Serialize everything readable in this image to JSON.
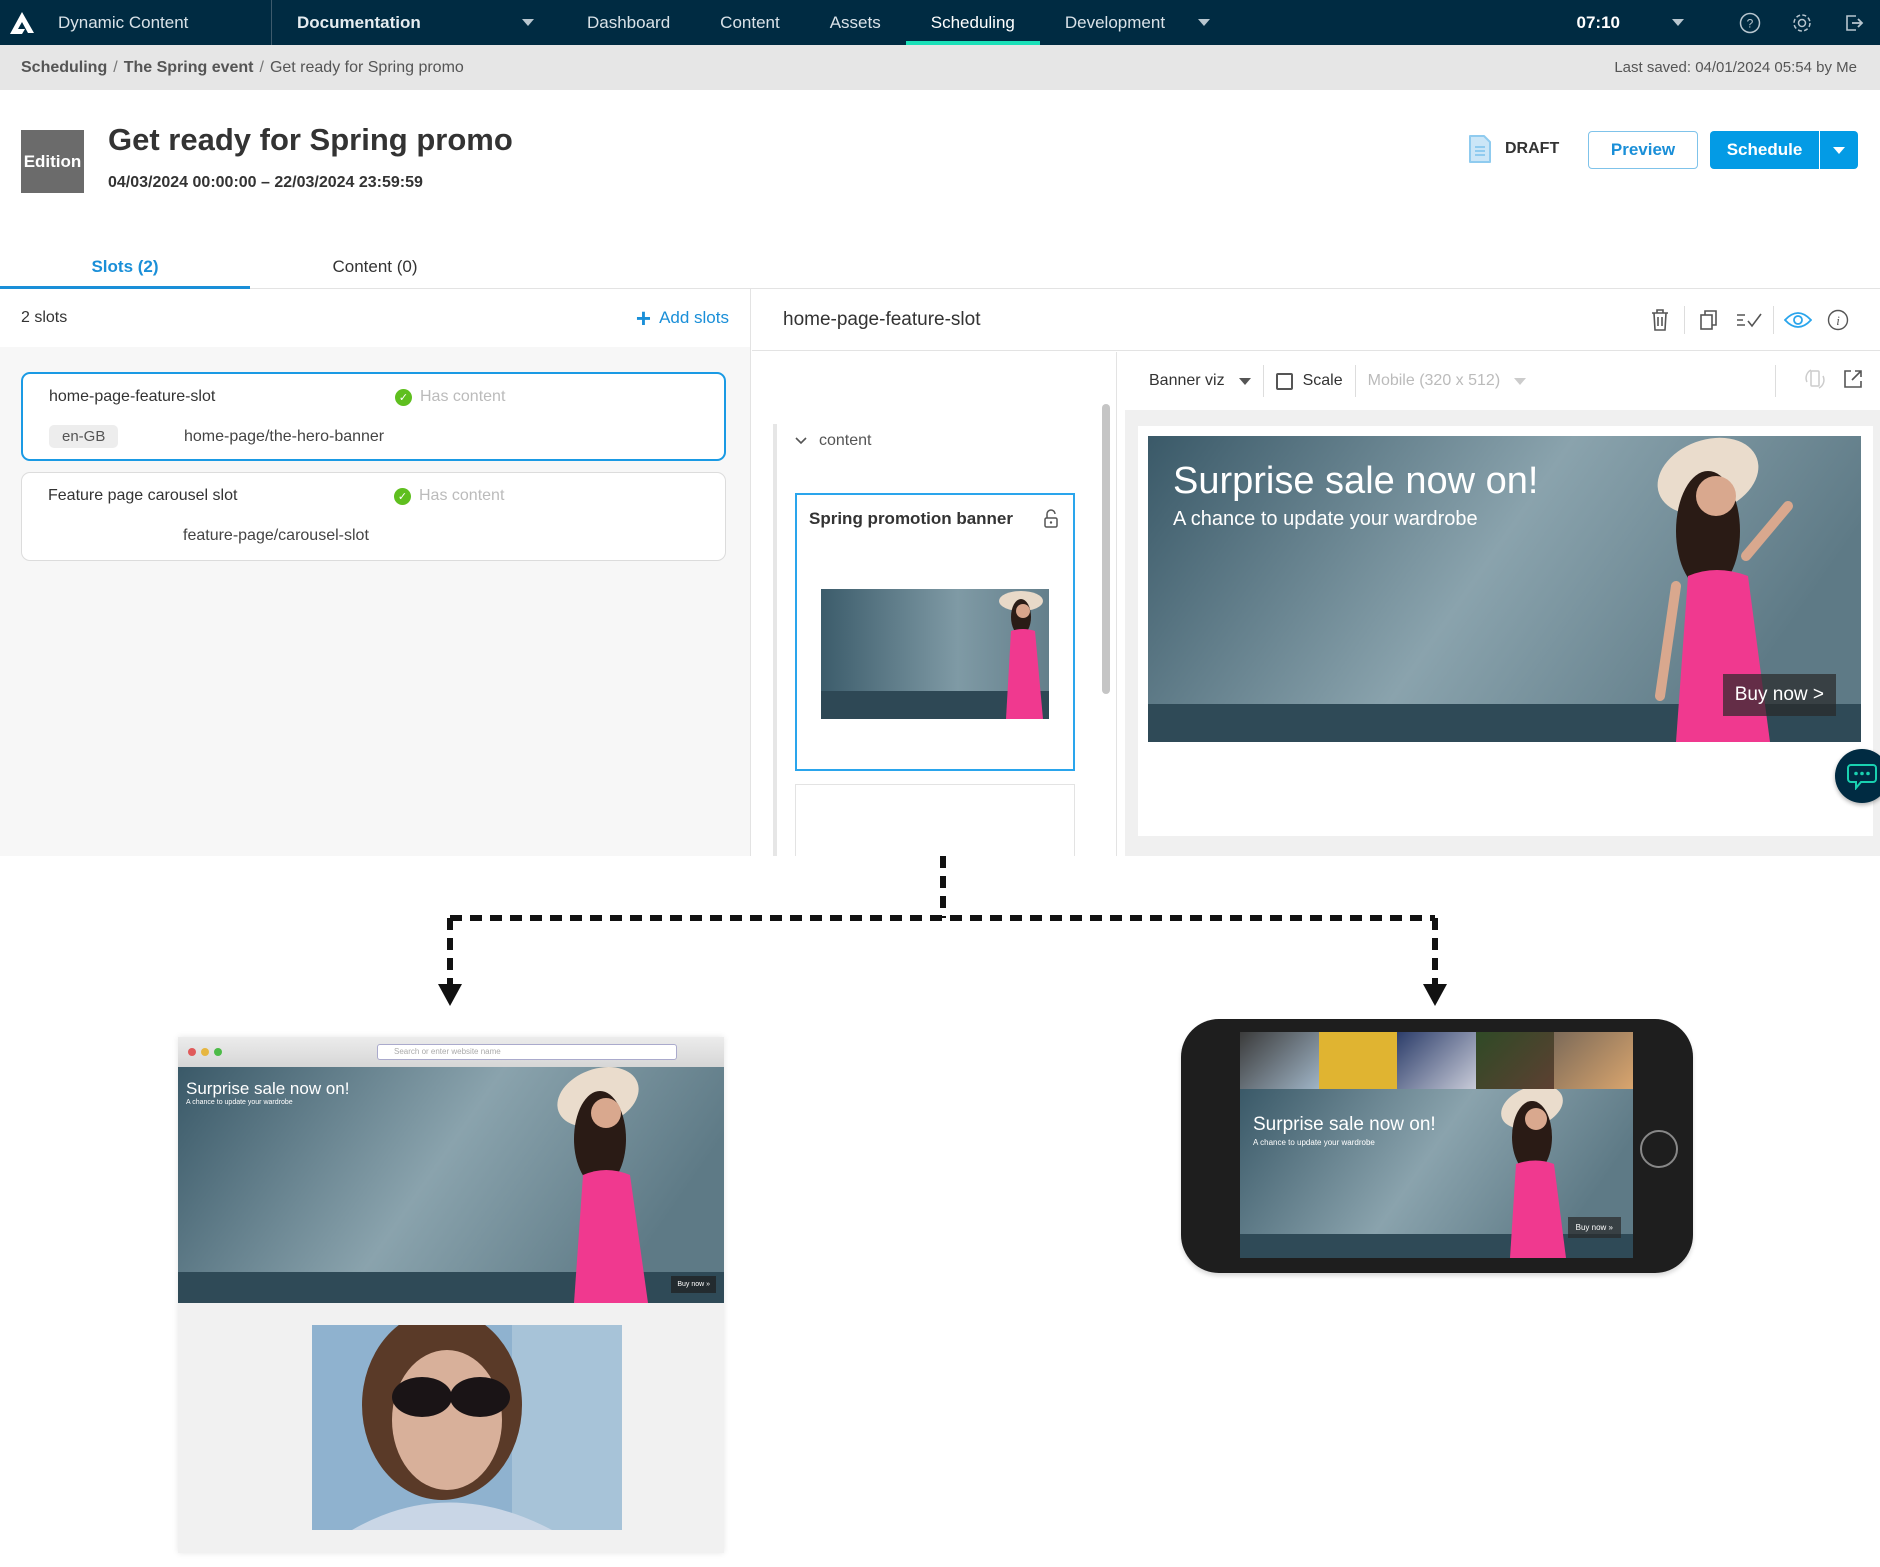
{
  "topnav": {
    "app_title": "Dynamic Content",
    "hub": "Documentation",
    "items": [
      {
        "label": "Dashboard",
        "active": false
      },
      {
        "label": "Content",
        "active": false
      },
      {
        "label": "Assets",
        "active": false
      },
      {
        "label": "Scheduling",
        "active": true
      },
      {
        "label": "Development",
        "active": false
      }
    ],
    "clock": "07:10",
    "icons": [
      "help-icon",
      "settings-icon",
      "logout-icon"
    ]
  },
  "breadcrumb": {
    "items": [
      "Scheduling",
      "The Spring event",
      "Get ready for Spring promo"
    ],
    "last_saved": "Last saved: 04/01/2024 05:54 by Me"
  },
  "header": {
    "badge": "Edition",
    "title": "Get ready for Spring promo",
    "dates": "04/03/2024 00:00:00  –  22/03/2024 23:59:59",
    "status": "DRAFT",
    "preview_label": "Preview",
    "schedule_label": "Schedule"
  },
  "tabs": [
    {
      "label": "Slots (2)",
      "active": true
    },
    {
      "label": "Content (0)",
      "active": false
    }
  ],
  "slots_panel": {
    "count_label": "2 slots",
    "add_label": "Add slots",
    "slots": [
      {
        "name": "home-page-feature-slot",
        "status": "Has content",
        "locale": "en-GB",
        "path": "home-page/the-hero-banner",
        "selected": true
      },
      {
        "name": "Feature page carousel slot",
        "status": "Has content",
        "locale": "",
        "path": "feature-page/carousel-slot",
        "selected": false
      }
    ]
  },
  "slot_detail": {
    "title": "home-page-feature-slot",
    "tree_label": "content",
    "content_item_title": "Spring promotion banner",
    "viz_select": "Banner viz",
    "scale_label": "Scale",
    "device_select": "Mobile (320 x 512)"
  },
  "banner": {
    "headline": "Surprise sale now on!",
    "subhead": "A chance to update your wardrobe",
    "cta": "Buy now >",
    "cta_small": "Buy now »"
  },
  "diagram": {
    "browser_url_placeholder": "Search or enter website name"
  },
  "colors": {
    "nav_bg": "#002b42",
    "accent": "#039be5",
    "active_tab_indicator": "#19e0b8",
    "success": "#5fbf1f",
    "dress_pink": "#f0398f"
  }
}
